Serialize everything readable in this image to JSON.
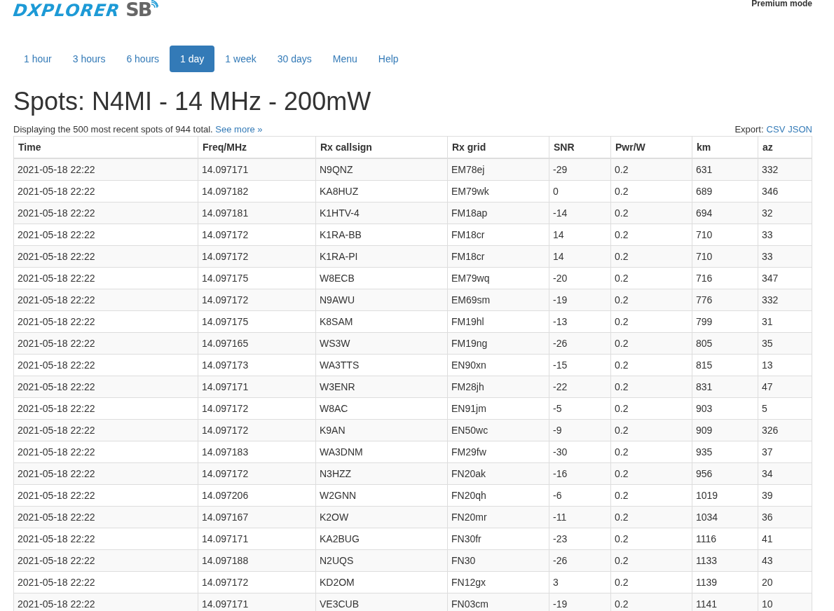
{
  "logo": {
    "wordmark": "DXPLORER",
    "badge": "SB"
  },
  "account": {
    "mode": "Premium mode"
  },
  "tabs": [
    {
      "label": "1 hour",
      "selected": false
    },
    {
      "label": "3 hours",
      "selected": false
    },
    {
      "label": "6 hours",
      "selected": false
    },
    {
      "label": "1 day",
      "selected": true
    },
    {
      "label": "1 week",
      "selected": false
    },
    {
      "label": "30 days",
      "selected": false
    },
    {
      "label": "Menu",
      "selected": false
    },
    {
      "label": "Help",
      "selected": false
    }
  ],
  "heading": "Spots: N4MI - 14 MHz - 200mW",
  "summary": {
    "text": "Displaying the 500 most recent spots of 944 total.",
    "link": "See more »"
  },
  "export": {
    "label": "Export:",
    "links": [
      "CSV",
      "JSON"
    ]
  },
  "table": {
    "columns": [
      "Time",
      "Freq/MHz",
      "Rx callsign",
      "Rx grid",
      "SNR",
      "Pwr/W",
      "km",
      "az"
    ],
    "rows": [
      [
        "2021-05-18 22:22",
        "14.097171",
        "N9QNZ",
        "EM78ej",
        "-29",
        "0.2",
        "631",
        "332"
      ],
      [
        "2021-05-18 22:22",
        "14.097182",
        "KA8HUZ",
        "EM79wk",
        "0",
        "0.2",
        "689",
        "346"
      ],
      [
        "2021-05-18 22:22",
        "14.097181",
        "K1HTV-4",
        "FM18ap",
        "-14",
        "0.2",
        "694",
        "32"
      ],
      [
        "2021-05-18 22:22",
        "14.097172",
        "K1RA-BB",
        "FM18cr",
        "14",
        "0.2",
        "710",
        "33"
      ],
      [
        "2021-05-18 22:22",
        "14.097172",
        "K1RA-PI",
        "FM18cr",
        "14",
        "0.2",
        "710",
        "33"
      ],
      [
        "2021-05-18 22:22",
        "14.097175",
        "W8ECB",
        "EM79wq",
        "-20",
        "0.2",
        "716",
        "347"
      ],
      [
        "2021-05-18 22:22",
        "14.097172",
        "N9AWU",
        "EM69sm",
        "-19",
        "0.2",
        "776",
        "332"
      ],
      [
        "2021-05-18 22:22",
        "14.097175",
        "K8SAM",
        "FM19hl",
        "-13",
        "0.2",
        "799",
        "31"
      ],
      [
        "2021-05-18 22:22",
        "14.097165",
        "WS3W",
        "FM19ng",
        "-26",
        "0.2",
        "805",
        "35"
      ],
      [
        "2021-05-18 22:22",
        "14.097173",
        "WA3TTS",
        "EN90xn",
        "-15",
        "0.2",
        "815",
        "13"
      ],
      [
        "2021-05-18 22:22",
        "14.097171",
        "W3ENR",
        "FM28jh",
        "-22",
        "0.2",
        "831",
        "47"
      ],
      [
        "2021-05-18 22:22",
        "14.097172",
        "W8AC",
        "EN91jm",
        "-5",
        "0.2",
        "903",
        "5"
      ],
      [
        "2021-05-18 22:22",
        "14.097172",
        "K9AN",
        "EN50wc",
        "-9",
        "0.2",
        "909",
        "326"
      ],
      [
        "2021-05-18 22:22",
        "14.097183",
        "WA3DNM",
        "FM29fw",
        "-30",
        "0.2",
        "935",
        "37"
      ],
      [
        "2021-05-18 22:22",
        "14.097172",
        "N3HZZ",
        "FN20ak",
        "-16",
        "0.2",
        "956",
        "34"
      ],
      [
        "2021-05-18 22:22",
        "14.097206",
        "W2GNN",
        "FN20qh",
        "-6",
        "0.2",
        "1019",
        "39"
      ],
      [
        "2021-05-18 22:22",
        "14.097167",
        "K2OW",
        "FN20mr",
        "-11",
        "0.2",
        "1034",
        "36"
      ],
      [
        "2021-05-18 22:22",
        "14.097171",
        "KA2BUG",
        "FN30fr",
        "-23",
        "0.2",
        "1116",
        "41"
      ],
      [
        "2021-05-18 22:22",
        "14.097188",
        "N2UQS",
        "FN30",
        "-26",
        "0.2",
        "1133",
        "43"
      ],
      [
        "2021-05-18 22:22",
        "14.097172",
        "KD2OM",
        "FN12gx",
        "3",
        "0.2",
        "1139",
        "20"
      ],
      [
        "2021-05-18 22:22",
        "14.097171",
        "VE3CUB",
        "FN03cm",
        "-19",
        "0.2",
        "1141",
        "10"
      ]
    ]
  }
}
